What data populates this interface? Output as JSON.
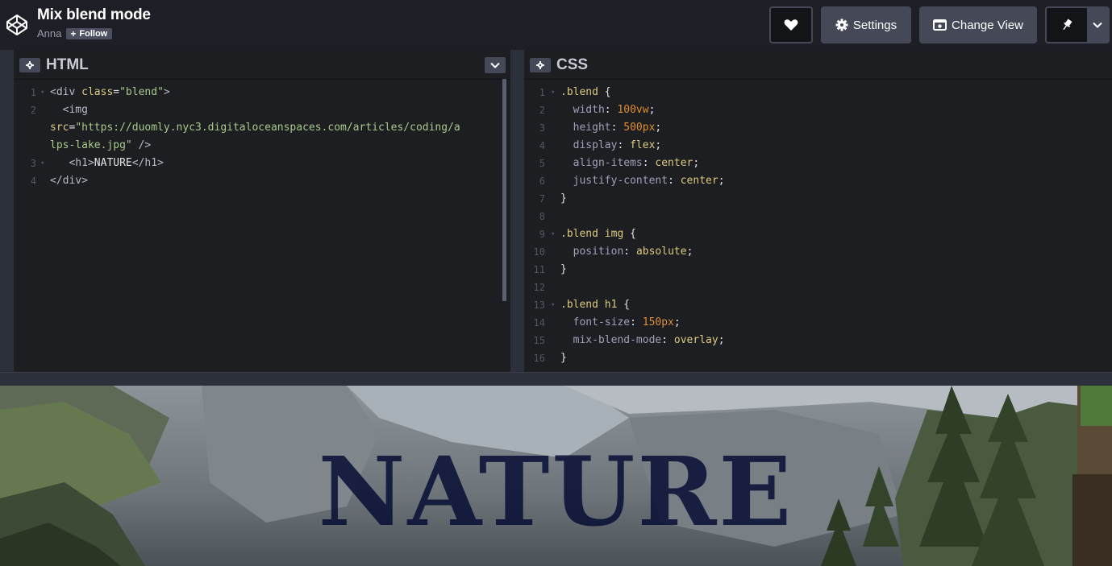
{
  "header": {
    "title": "Mix blend mode",
    "author": "Anna",
    "follow_label": "Follow",
    "settings_label": "Settings",
    "change_view_label": "Change View",
    "icons": [
      "codepen-logo-icon",
      "heart-icon",
      "gear-icon",
      "change-view-icon",
      "pin-icon",
      "chevron-down-icon"
    ]
  },
  "html_panel": {
    "title": "HTML",
    "line_numbers": [
      "1",
      "2",
      "",
      "",
      "3",
      "4"
    ],
    "lines": [
      {
        "indent": "",
        "segments": [
          [
            "tag",
            "<div "
          ],
          [
            "attr",
            "class"
          ],
          [
            "punc",
            "="
          ],
          [
            "str",
            "\"blend\""
          ],
          [
            "tag",
            ">"
          ]
        ]
      },
      {
        "indent": "  ",
        "segments": [
          [
            "tag",
            "<img"
          ]
        ]
      },
      {
        "indent": "",
        "segments": [
          [
            "attr",
            "src"
          ],
          [
            "punc",
            "="
          ],
          [
            "str",
            "\"https://duomly.nyc3.digitaloceanspaces.com/articles/coding/a"
          ]
        ]
      },
      {
        "indent": "",
        "segments": [
          [
            "str",
            "lps-lake.jpg\""
          ],
          [
            "tag",
            " />"
          ]
        ]
      },
      {
        "indent": "   ",
        "segments": [
          [
            "tag",
            "<h1>"
          ],
          [
            "punc",
            "NATURE"
          ],
          [
            "tag",
            "</h1>"
          ]
        ]
      },
      {
        "indent": "",
        "segments": [
          [
            "tag",
            "</div>"
          ]
        ]
      }
    ]
  },
  "css_panel": {
    "title": "CSS",
    "lines": [
      {
        "n": "1",
        "segments": [
          [
            "sel",
            ".blend"
          ],
          [
            "punc",
            " {"
          ]
        ]
      },
      {
        "n": "2",
        "segments": [
          [
            "prop",
            "  width"
          ],
          [
            "punc",
            ": "
          ],
          [
            "num",
            "100vw"
          ],
          [
            "punc",
            ";"
          ]
        ]
      },
      {
        "n": "3",
        "segments": [
          [
            "prop",
            "  height"
          ],
          [
            "punc",
            ": "
          ],
          [
            "num",
            "500px"
          ],
          [
            "punc",
            ";"
          ]
        ]
      },
      {
        "n": "4",
        "segments": [
          [
            "prop",
            "  display"
          ],
          [
            "punc",
            ": "
          ],
          [
            "kw",
            "flex"
          ],
          [
            "punc",
            ";"
          ]
        ]
      },
      {
        "n": "5",
        "segments": [
          [
            "prop",
            "  align-items"
          ],
          [
            "punc",
            ": "
          ],
          [
            "kw",
            "center"
          ],
          [
            "punc",
            ";"
          ]
        ]
      },
      {
        "n": "6",
        "segments": [
          [
            "prop",
            "  justify-content"
          ],
          [
            "punc",
            ": "
          ],
          [
            "kw",
            "center"
          ],
          [
            "punc",
            ";"
          ]
        ]
      },
      {
        "n": "7",
        "segments": [
          [
            "punc",
            "}"
          ]
        ]
      },
      {
        "n": "8",
        "segments": []
      },
      {
        "n": "9",
        "segments": [
          [
            "sel",
            ".blend img"
          ],
          [
            "punc",
            " {"
          ]
        ]
      },
      {
        "n": "10",
        "segments": [
          [
            "prop",
            "  position"
          ],
          [
            "punc",
            ": "
          ],
          [
            "kw",
            "absolute"
          ],
          [
            "punc",
            ";"
          ]
        ]
      },
      {
        "n": "11",
        "segments": [
          [
            "punc",
            "}"
          ]
        ]
      },
      {
        "n": "12",
        "segments": []
      },
      {
        "n": "13",
        "segments": [
          [
            "sel",
            ".blend h1"
          ],
          [
            "punc",
            " {"
          ]
        ]
      },
      {
        "n": "14",
        "segments": [
          [
            "prop",
            "  font-size"
          ],
          [
            "punc",
            ": "
          ],
          [
            "num",
            "150px"
          ],
          [
            "punc",
            ";"
          ]
        ]
      },
      {
        "n": "15",
        "segments": [
          [
            "prop",
            "  mix-blend-mode"
          ],
          [
            "punc",
            ": "
          ],
          [
            "kw",
            "overlay"
          ],
          [
            "punc",
            ";"
          ]
        ]
      },
      {
        "n": "16",
        "segments": [
          [
            "punc",
            "}"
          ]
        ]
      }
    ]
  },
  "preview": {
    "heading": "NATURE"
  }
}
